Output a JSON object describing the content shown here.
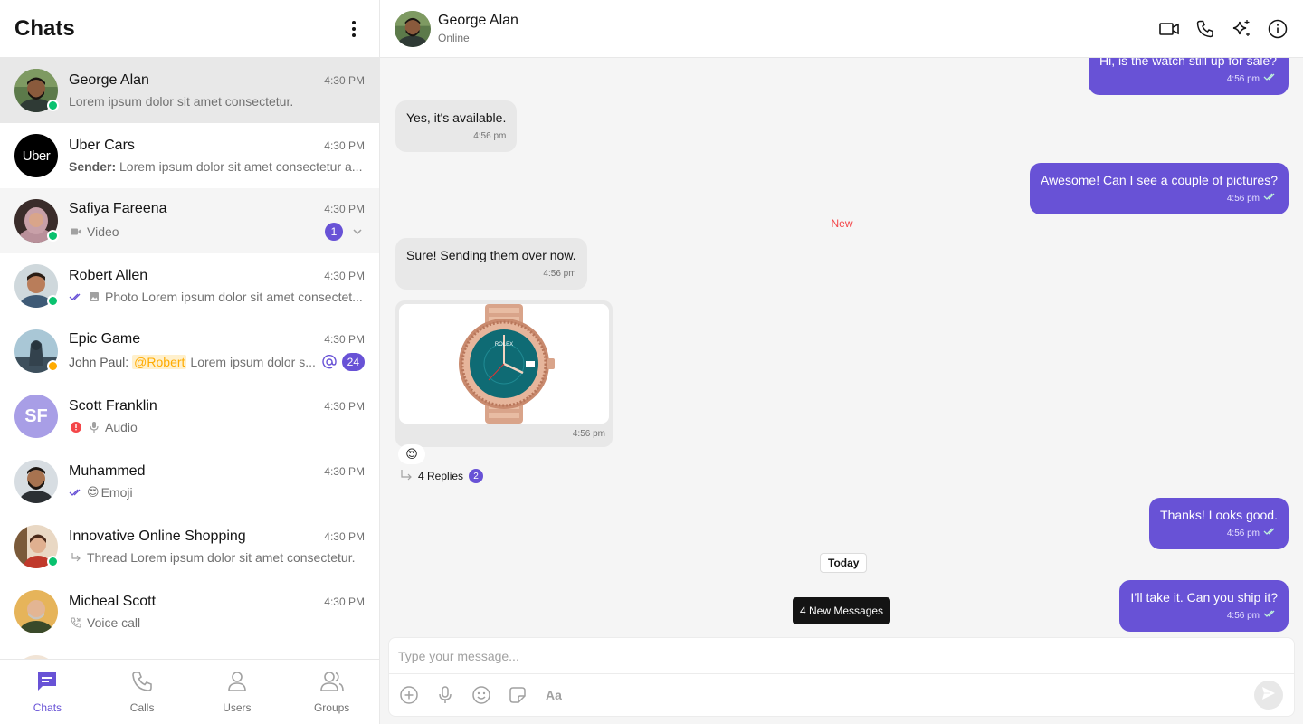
{
  "sidebar": {
    "title": "Chats",
    "chats": [
      {
        "name": "George Alan",
        "time": "4:30 PM",
        "preview": "Lorem ipsum dolor sit amet consectetur."
      },
      {
        "name": "Uber Cars",
        "time": "4:30 PM",
        "sender": "Sender:",
        "preview": "Lorem ipsum dolor sit amet consectetur a..."
      },
      {
        "name": "Safiya Fareena",
        "time": "4:30 PM",
        "preview": "Video",
        "unread": "1"
      },
      {
        "name": "Robert Allen",
        "time": "4:30 PM",
        "preview": "Photo Lorem ipsum dolor sit amet consectet..."
      },
      {
        "name": "Epic Game",
        "time": "4:30 PM",
        "sender": "John Paul:",
        "mention": "@Robert",
        "preview": "Lorem ipsum dolor s...",
        "unread": "24"
      },
      {
        "name": "Scott Franklin",
        "time": "4:30 PM",
        "preview": "Audio",
        "initials": "SF"
      },
      {
        "name": "Muhammed",
        "time": "4:30 PM",
        "preview": "Emoji"
      },
      {
        "name": "Innovative Online Shopping",
        "time": "4:30 PM",
        "preview": "Thread Lorem ipsum dolor sit amet consectetur."
      },
      {
        "name": "Micheal Scott",
        "time": "4:30 PM",
        "preview": "Voice call"
      }
    ],
    "uber_logo_text": "Uber",
    "nav": [
      {
        "label": "Chats",
        "icon": "chat-icon"
      },
      {
        "label": "Calls",
        "icon": "phone-icon"
      },
      {
        "label": "Users",
        "icon": "user-icon"
      },
      {
        "label": "Groups",
        "icon": "group-icon"
      }
    ]
  },
  "header": {
    "name": "George Alan",
    "status": "Online"
  },
  "messages": {
    "m0": {
      "text": "Hi, is the watch still up for sale?",
      "time": "4:56 pm"
    },
    "m1": {
      "text": "Yes, it's available.",
      "time": "4:56 pm"
    },
    "m2": {
      "text": "Awesome! Can I see a couple of pictures?",
      "time": "4:56 pm"
    },
    "new_divider": "New",
    "m3": {
      "text": "Sure! Sending them over now.",
      "time": "4:56 pm"
    },
    "m4": {
      "time": "4:56 pm",
      "reaction": "😍",
      "replies": "4 Replies",
      "replies_badge": "2",
      "watch_brand": "ROLEX"
    },
    "m5": {
      "text": "Thanks! Looks good.",
      "time": "4:56 pm"
    },
    "today": "Today",
    "m6": {
      "text": "I’ll take it. Can you ship it?",
      "time": "4:56 pm"
    },
    "new_messages": "4 New Messages"
  },
  "composer": {
    "placeholder": "Type your message...",
    "text_format": "Aa"
  },
  "colors": {
    "primary": "#6852d6",
    "incoming_bubble": "#e8e8e8",
    "online": "#09c26f",
    "error": "#f44649",
    "background": "#f5f5f5"
  }
}
